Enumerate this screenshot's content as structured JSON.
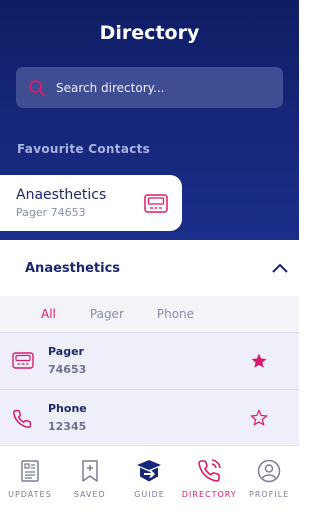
{
  "colors": {
    "navy": "#16277b",
    "accent": "#d81b6f",
    "search_bg": "#3f4d93"
  },
  "header": {
    "title": "Directory"
  },
  "search": {
    "placeholder": "Search directory..."
  },
  "favourites": {
    "heading": "Favourite Contacts",
    "items": [
      {
        "name": "Anaesthetics",
        "detail": "Pager 74653",
        "icon": "pager-icon"
      }
    ]
  },
  "detail": {
    "title": "Anaesthetics",
    "expanded": true,
    "filters": [
      {
        "label": "All",
        "active": true
      },
      {
        "label": "Pager",
        "active": false
      },
      {
        "label": "Phone",
        "active": false
      }
    ],
    "contacts": [
      {
        "type": "Pager",
        "number": "74653",
        "icon": "pager-icon",
        "favourite": true
      },
      {
        "type": "Phone",
        "number": "12345",
        "icon": "phone-icon",
        "favourite": false
      }
    ]
  },
  "tabbar": {
    "tabs": [
      {
        "label": "UPDATES",
        "icon": "newspaper-icon",
        "active": false
      },
      {
        "label": "SAVED",
        "icon": "bookmark-icon",
        "active": false
      },
      {
        "label": "GUIDE",
        "icon": "guide-icon",
        "active": false
      },
      {
        "label": "DIRECTORY",
        "icon": "phone-call-icon",
        "active": true
      },
      {
        "label": "PROFILE",
        "icon": "profile-icon",
        "active": false
      }
    ]
  }
}
